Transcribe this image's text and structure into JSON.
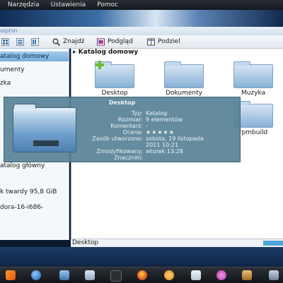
{
  "menubar": {
    "items": [
      "Narzędzia",
      "Ustawienia",
      "Pomoc"
    ]
  },
  "window": {
    "title": "olphin"
  },
  "toolbar": {
    "find": "Znajdź",
    "preview": "Podgląd",
    "split": "Podziel"
  },
  "sidebar": {
    "items": [
      {
        "label": "atalog domowy",
        "selected": true
      },
      {
        "label": "umenty",
        "selected": false
      },
      {
        "label": "zka",
        "selected": false
      },
      {
        "label": "atalog główny",
        "selected": false
      },
      {
        "label": "k twardy 95,8 GiB",
        "selected": false
      },
      {
        "label": "dora-16-i686-",
        "selected": false
      }
    ]
  },
  "breadcrumb": "Katalog domowy",
  "folders": [
    "Desktop",
    "Dokumenty",
    "Muzyka",
    "rpmbuild"
  ],
  "tooltip": {
    "title": "Desktop",
    "rows": [
      {
        "k": "Typ:",
        "v": "Katalog"
      },
      {
        "k": "Rozmiar:",
        "v": "9 elementów"
      },
      {
        "k": "Komentarz:",
        "v": "-"
      },
      {
        "k": "Ocena:",
        "v": "★★★★★"
      },
      {
        "k": "Zasób utworzono:",
        "v": "sobota, 19 listopada"
      },
      {
        "k": "",
        "v": "2011 10:21"
      },
      {
        "k": "Zmodyfikowany:",
        "v": "wtorek 13:28"
      },
      {
        "k": "Znaczniki:",
        "v": ""
      }
    ]
  },
  "statusbar": {
    "text": "Desktop"
  },
  "colors": {
    "accent": "#78aedb",
    "tooltip_bg": "#58829a",
    "taskbar": "#1a1e22"
  },
  "icons": [
    "search-icon",
    "preview-icon",
    "split-icon",
    "add-emblem-icon",
    "folder-icon"
  ]
}
